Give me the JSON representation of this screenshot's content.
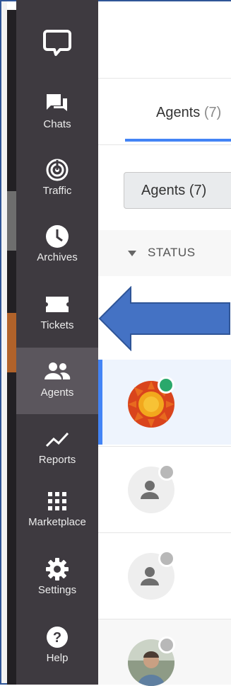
{
  "sidebar": {
    "logo_icon": "chat-bubble-icon",
    "items": [
      {
        "key": "chats",
        "label": "Chats",
        "icon": "chats-icon"
      },
      {
        "key": "traffic",
        "label": "Traffic",
        "icon": "traffic-icon"
      },
      {
        "key": "archives",
        "label": "Archives",
        "icon": "clock-icon"
      },
      {
        "key": "tickets",
        "label": "Tickets",
        "icon": "ticket-icon"
      },
      {
        "key": "agents",
        "label": "Agents",
        "icon": "agents-icon",
        "active": true
      },
      {
        "key": "reports",
        "label": "Reports",
        "icon": "chart-line-icon"
      },
      {
        "key": "marketplace",
        "label": "Marketplace",
        "icon": "grid-icon"
      },
      {
        "key": "settings",
        "label": "Settings",
        "icon": "gear-icon"
      },
      {
        "key": "help",
        "label": "Help",
        "icon": "help-icon"
      }
    ]
  },
  "main": {
    "tab": {
      "label": "Agents",
      "count": "(7)"
    },
    "filter_chip": "Agents (7)",
    "status_header": "STATUS",
    "agents": [
      {
        "avatar": "logo-avatar",
        "status": "online"
      },
      {
        "avatar": "placeholder-avatar",
        "status": "offline"
      },
      {
        "avatar": "placeholder-avatar",
        "status": "offline"
      },
      {
        "avatar": "photo-avatar",
        "status": "offline"
      }
    ]
  },
  "colors": {
    "sidebar_bg": "#3e3a40",
    "sidebar_active": "#5b565d",
    "accent_blue": "#4384f5",
    "annotation_arrow": "#4472c4",
    "online_green": "#2aa86b",
    "offline_gray": "#b8b8b8"
  }
}
